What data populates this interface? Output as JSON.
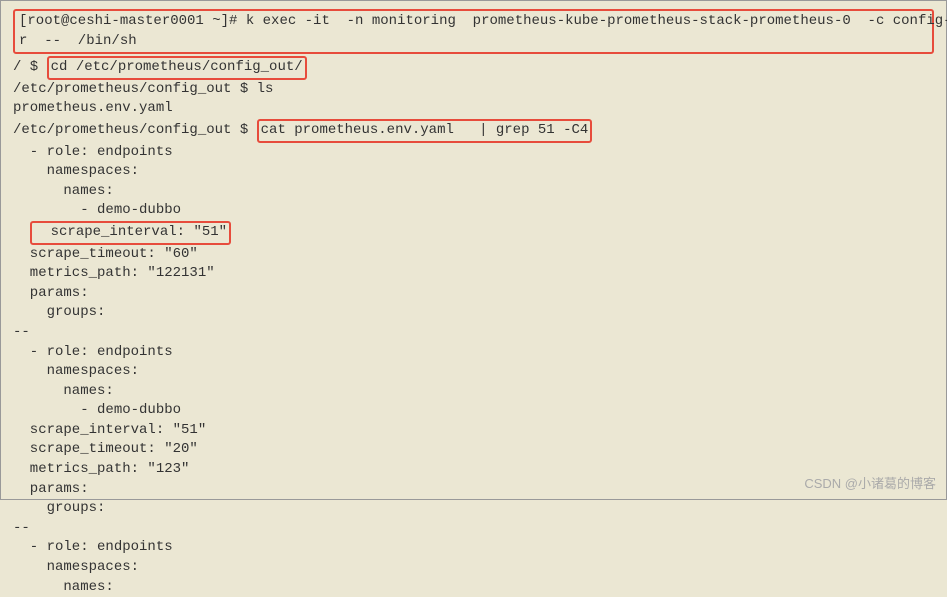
{
  "header": {
    "prompt1": "[root@ceshi-master0001 ~]# ",
    "cmd1": "k exec -it  -n monitoring  prometheus-kube-prometheus-stack-prometheus-0  -c config-reloade",
    "cmd1b": "r  --  /bin/sh"
  },
  "lines": {
    "l1_prompt": "/ $ ",
    "l1_cmd": "cd /etc/prometheus/config_out/",
    "l2": "/etc/prometheus/config_out $ ls",
    "l3": "prometheus.env.yaml",
    "l4_prompt": "/etc/prometheus/config_out $ ",
    "l4_cmd": "cat prometheus.env.yaml   | grep 51 -C4",
    "l5": "  - role: endpoints",
    "l6": "    namespaces:",
    "l7": "      names:",
    "l8": "        - demo-dubbo",
    "l9": "  scrape_interval: \"51\"",
    "l10": "  scrape_timeout: \"60\"",
    "l11": "  metrics_path: \"122131\"",
    "l12": "  params:",
    "l13": "    groups:",
    "l14": "--",
    "l15": "  - role: endpoints",
    "l16": "    namespaces:",
    "l17": "      names:",
    "l18": "        - demo-dubbo",
    "l19": "  scrape_interval: \"51\"",
    "l20": "  scrape_timeout: \"20\"",
    "l21": "  metrics_path: \"123\"",
    "l22": "  params:",
    "l23": "    groups:",
    "l24": "--",
    "l25": "  - role: endpoints",
    "l26": "    namespaces:",
    "l27": "      names:"
  },
  "watermark": "CSDN @小诸葛的博客"
}
